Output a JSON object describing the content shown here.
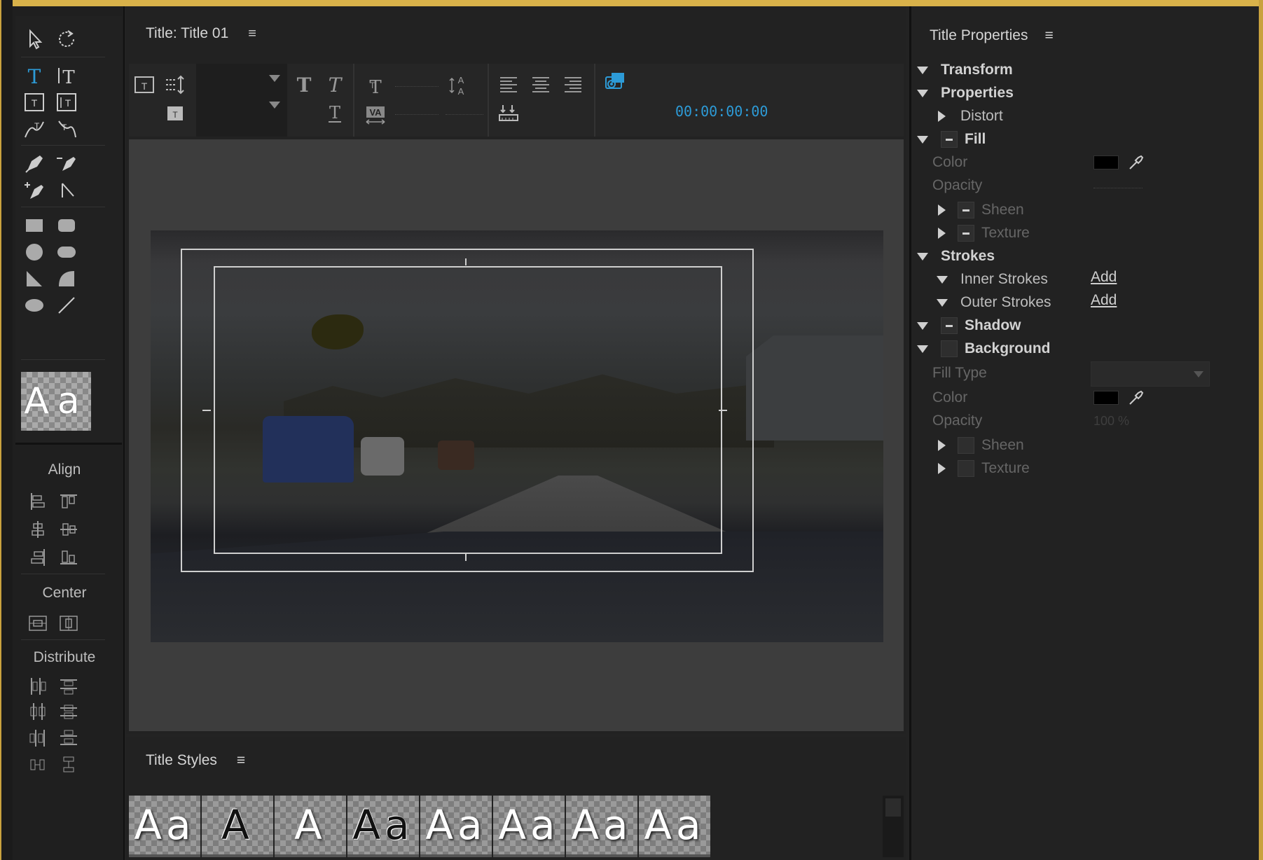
{
  "colors": {
    "accent": "#2d9bd7",
    "frame": "#d9b24a",
    "panel_bg": "#222222",
    "canvas_bg": "#3d3d3d"
  },
  "title_panel": {
    "title": "Title: Title 01",
    "menu_icon": "≡",
    "timecode": "00:00:00:00"
  },
  "tools": {
    "style_preview": "Aa",
    "align": {
      "title": "Align"
    },
    "center": {
      "title": "Center"
    },
    "distribute": {
      "title": "Distribute"
    }
  },
  "title_styles": {
    "title": "Title Styles",
    "menu_icon": "≡",
    "swatches": [
      "Aa",
      "A",
      "A",
      "Aa",
      "Aa",
      "Aa",
      "Aa",
      "Aa"
    ]
  },
  "properties": {
    "title": "Title Properties",
    "menu_icon": "≡",
    "transform": "Transform",
    "properties": "Properties",
    "distort": "Distort",
    "fill": "Fill",
    "fill_color": "Color",
    "fill_opacity": "Opacity",
    "fill_sheen": "Sheen",
    "fill_texture": "Texture",
    "strokes": "Strokes",
    "inner_strokes": "Inner Strokes",
    "outer_strokes": "Outer Strokes",
    "add": "Add",
    "shadow": "Shadow",
    "background": "Background",
    "bg_fill_type": "Fill Type",
    "bg_color": "Color",
    "bg_opacity": "Opacity",
    "bg_opacity_value": "100 %",
    "bg_sheen": "Sheen",
    "bg_texture": "Texture"
  }
}
